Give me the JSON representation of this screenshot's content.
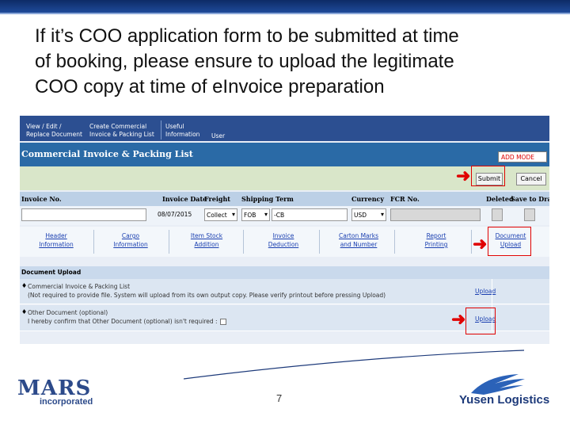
{
  "slide": {
    "title_lines": [
      "If it’s COO application form to be submitted at time",
      "of booking, please ensure to upload the legitimate",
      "COO copy at time of eInvoice preparation"
    ],
    "page_number": "7"
  },
  "app": {
    "nav": [
      {
        "label": "View / Edit /\nReplace Document"
      },
      {
        "label": "Create Commercial\nInvoice & Packing List"
      },
      {
        "label": "Useful\nInformation"
      },
      {
        "label": "User"
      }
    ],
    "title": "Commercial Invoice & Packing List",
    "mode": "ADD MODE",
    "buttons": {
      "submit": "Submit",
      "cancel": "Cancel"
    },
    "columns": {
      "invoice_no": "Invoice No.",
      "invoice_date": "Invoice Date",
      "freight": "Freight",
      "shipping_term": "Shipping Term",
      "currency": "Currency",
      "fcr_no": "FCR No.",
      "deleted": "Deleted",
      "save_to_draft": "Save to Draft"
    },
    "values": {
      "invoice_no": "",
      "invoice_date": "08/07/2015",
      "freight": "Collect",
      "shipping_term": "FOB",
      "shipping_term_text": "-CB",
      "currency": "USD",
      "fcr_no": ""
    },
    "tabs": [
      {
        "label": "Header\nInformation"
      },
      {
        "label": "Cargo\nInformation"
      },
      {
        "label": "Item Stock\nAddition"
      },
      {
        "label": "Invoice\nDeduction"
      },
      {
        "label": "Carton Marks\nand Number"
      },
      {
        "label": "Report\nPrinting"
      },
      {
        "label": "Document\nUpload"
      }
    ],
    "document_upload": {
      "header": "Document Upload",
      "rows": [
        {
          "title": "Commercial Invoice & Packing List",
          "note": "(Not required to provide file. System will upload from its own output copy. Please verify printout before pressing Upload)",
          "link": "Upload"
        },
        {
          "title": "Other Document (optional)",
          "note": "I hereby confirm that Other Document (optional) isn't required :",
          "link": "Upload"
        }
      ]
    }
  },
  "logos": {
    "left": {
      "name": "MARS",
      "sub": "incorporated"
    },
    "right": {
      "name": "Yusen Logistics"
    }
  },
  "colors": {
    "highlight": "#e00000",
    "nav": "#2c4f91",
    "title_bar": "#2a6aa6"
  }
}
